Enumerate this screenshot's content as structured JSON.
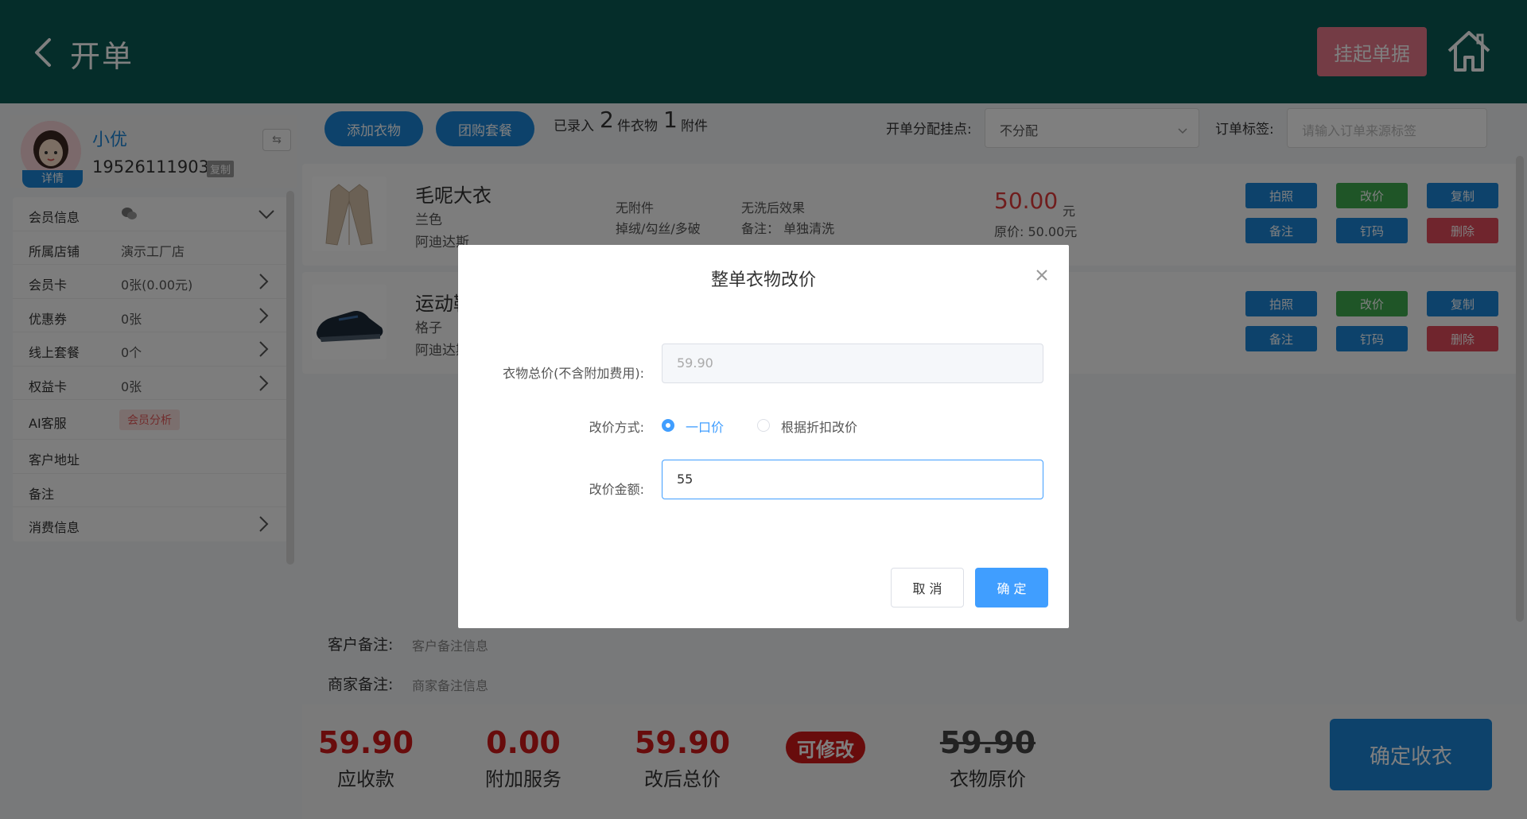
{
  "header": {
    "title": "开单",
    "hang_label": "挂起单据"
  },
  "customer": {
    "name": "小优",
    "phone": "19526111903",
    "copy_label": "复制",
    "detail_label": "详情",
    "switch_label": "⇆"
  },
  "info_list": [
    {
      "label": "会员信息",
      "value": "",
      "icon": "wechat-icon",
      "chevron": "down"
    },
    {
      "label": "所属店铺",
      "value": "演示工厂店",
      "chevron": ""
    },
    {
      "label": "会员卡",
      "value": "0张(0.00元)",
      "chevron": "right"
    },
    {
      "label": "优惠券",
      "value": "0张",
      "chevron": "right"
    },
    {
      "label": "线上套餐",
      "value": "0个",
      "chevron": "right"
    },
    {
      "label": "权益卡",
      "value": "0张",
      "chevron": "right"
    },
    {
      "label": "AI客服",
      "value": "会员分析",
      "chevron": ""
    },
    {
      "label": "客户地址",
      "value": "",
      "chevron": ""
    },
    {
      "label": "备注",
      "value": "",
      "chevron": ""
    },
    {
      "label": "消费信息",
      "value": "",
      "chevron": "right"
    }
  ],
  "toolbar": {
    "add_clothes": "添加衣物",
    "group_package": "团购套餐",
    "entered_prefix": "已录入",
    "clothes_count": "2",
    "clothes_unit": "件衣物",
    "attach_count": "1",
    "attach_unit": "附件",
    "assign_label": "开单分配挂点:",
    "assign_value": "不分配",
    "tag_label": "订单标签:",
    "tag_placeholder": "请输入订单来源标签"
  },
  "items": [
    {
      "name": "毛呢大衣",
      "color": "兰色",
      "brand": "阿迪达斯",
      "attachment": "无附件",
      "defect": "掉绒/勾丝/多破",
      "effect": "无洗后效果",
      "note": "备注： 单独清洗",
      "price": "50.00",
      "unit": "元",
      "original": "原价: 50.00元"
    },
    {
      "name": "运动鞋",
      "color": "格子",
      "brand": "阿迪达斯",
      "attachment": "",
      "defect": "",
      "effect": "",
      "note": "",
      "price": "",
      "unit": "",
      "original": ""
    }
  ],
  "item_actions": {
    "photo": "拍照",
    "change_price": "改价",
    "copy": "复制",
    "remark": "备注",
    "code": "钉码",
    "delete": "删除"
  },
  "remarks": {
    "customer_label": "客户备注:",
    "customer_value": "客户备注信息",
    "merchant_label": "商家备注:",
    "merchant_value": "商家备注信息"
  },
  "footer": {
    "receivable": "59.90",
    "receivable_label": "应收款",
    "extra": "0.00",
    "extra_label": "附加服务",
    "after_total": "59.90",
    "after_total_label": "改后总价",
    "editable_badge": "可修改",
    "original_total": "59.90",
    "original_total_label": "衣物原价",
    "confirm_label": "确定收衣"
  },
  "modal": {
    "title": "整单衣物改价",
    "total_label": "衣物总价(不含附加费用):",
    "total_value": "59.90",
    "method_label": "改价方式:",
    "method_options": [
      "一口价",
      "根据折扣改价"
    ],
    "method_selected": "一口价",
    "amount_label": "改价金额:",
    "amount_value": "55",
    "cancel_label": "取 消",
    "ok_label": "确 定"
  },
  "colors": {
    "header_bg": "#0b5a55",
    "primary_blue": "#1a84d6",
    "price_red": "#d01818",
    "modal_blue": "#409eff"
  }
}
